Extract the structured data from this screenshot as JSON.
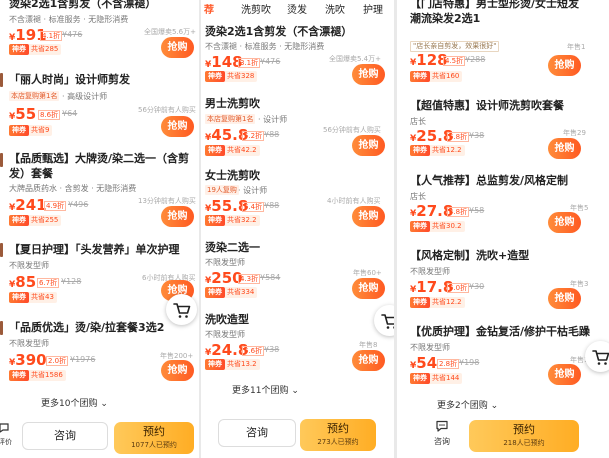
{
  "panels": {
    "left": {
      "top_partial": {
        "title": "烫染2选1含剪发（不含漂褪）",
        "subtitle": "不含漂褪 · 标准服务 · 无隐形消费",
        "price_symbol": "¥",
        "price": "191",
        "discount": "4.1折",
        "original": "¥476",
        "sales": "全国爆卖5.6万+",
        "cheap_label": "神券",
        "cheap_text": "共省285",
        "buy": "抢购"
      },
      "items": [
        {
          "title": "「丽人时尚」设计师剪发",
          "tag": "本店复购第1名",
          "subtitle": "· 高级设计师",
          "price_symbol": "¥",
          "price": "55",
          "discount": "8.6折",
          "original": "¥64",
          "recent": "56分钟前有人购买",
          "cheap_label": "神券",
          "cheap_text": "共省9",
          "buy": "抢购"
        },
        {
          "title_line1": "【品质甄选】大牌烫/染二选一（含剪",
          "title_line2": "发）套餐",
          "subtitle": "大牌品质药水 · 含剪发 · 无隐形消费",
          "price_symbol": "¥",
          "price": "241",
          "discount": "4.9折",
          "original": "¥496",
          "recent": "13分钟前有人购买",
          "cheap_label": "神券",
          "cheap_text": "共省255",
          "buy": "抢购"
        },
        {
          "title": "【夏日护理】「头发营养」单次护理",
          "subtitle": "不限发型师",
          "price_symbol": "¥",
          "price": "85",
          "discount": "6.7折",
          "original": "¥128",
          "recent": "6小时前有人购买",
          "cheap_label": "神券",
          "cheap_text": "共省43",
          "buy": "抢购"
        },
        {
          "title": "「品质优选」烫/染/拉套餐3选2",
          "subtitle": "不限发型师",
          "price_symbol": "¥",
          "price": "390",
          "discount": "2.0折",
          "original": "¥1976",
          "recent": "年售200+",
          "cheap_label": "神券",
          "cheap_text": "共省1586",
          "buy": "抢购"
        }
      ],
      "more": "更多10个团购",
      "consult": "咨询",
      "book": "预约",
      "book_count": "1077人已预约",
      "edge_label": "评价"
    },
    "middle": {
      "tabs": [
        "荐",
        "洗剪吹",
        "烫发",
        "洗吹",
        "护理"
      ],
      "items": [
        {
          "title": "烫染2选1含剪发（不含漂褪）",
          "subtitle": "不含漂褪 · 标准服务 · 无隐形消费",
          "price_symbol": "¥",
          "price": "148",
          "discount": "3.1折",
          "original": "¥476",
          "sales": "全国爆卖5.4万+",
          "cheap_label": "神券",
          "cheap_text": "共省328",
          "buy": "抢购"
        },
        {
          "title": "男士洗剪吹",
          "tag": "本店复购第1名",
          "subtitle": "· 设计师",
          "price_symbol": "¥",
          "price": "45.8",
          "discount": "5.2折",
          "original": "¥88",
          "recent": "56分钟前有人购买",
          "cheap_label": "神券",
          "cheap_text": "共省42.2",
          "buy": "抢购"
        },
        {
          "title": "女士洗剪吹",
          "tag": "19人复购",
          "subtitle": "· 设计师",
          "price_symbol": "¥",
          "price": "55.8",
          "discount": "6.4折",
          "original": "¥88",
          "recent": "4小时前有人购买",
          "cheap_label": "神券",
          "cheap_text": "共省32.2",
          "buy": "抢购"
        },
        {
          "title": "烫染二选一",
          "subtitle": "不限发型师",
          "price_symbol": "¥",
          "price": "250",
          "discount": "4.3折",
          "original": "¥584",
          "recent": "年售60+",
          "cheap_label": "神券",
          "cheap_text": "共省334",
          "buy": "抢购"
        },
        {
          "title": "洗吹造型",
          "subtitle": "不限发型师",
          "price_symbol": "¥",
          "price": "24.8",
          "discount": "6.6折",
          "original": "¥38",
          "recent": "年售8",
          "cheap_label": "神券",
          "cheap_text": "共省13.2",
          "buy": "抢购"
        }
      ],
      "more": "更多11个团购",
      "consult": "咨询",
      "book": "预约",
      "book_count": "273人已预约"
    },
    "right": {
      "items": [
        {
          "title_line1": "【门店特惠】男士型形烫/女士短发",
          "title_line2": "潮流染发2选1",
          "quote": "\"店长亲自剪发，效果很好\"",
          "price_symbol": "¥",
          "price": "128",
          "discount": "4.5折",
          "original": "¥288",
          "recent": "年售1",
          "cheap_label": "神券",
          "cheap_text": "共省160",
          "buy": "抢购"
        },
        {
          "title": "【超值特惠】设计师洗剪吹套餐",
          "subtitle": "店长",
          "price_symbol": "¥",
          "price": "25.8",
          "discount": "6.8折",
          "original": "¥38",
          "recent": "年售29",
          "cheap_label": "神券",
          "cheap_text": "共省12.2",
          "buy": "抢购"
        },
        {
          "title": "【人气推荐】总监剪发/风格定制",
          "subtitle": "店长",
          "price_symbol": "¥",
          "price": "27.8",
          "discount": "4.8折",
          "original": "¥58",
          "recent": "年售5",
          "cheap_label": "神券",
          "cheap_text": "共省30.2",
          "buy": "抢购"
        },
        {
          "title": "【风格定制】洗吹+造型",
          "subtitle": "不限发型师",
          "price_symbol": "¥",
          "price": "17.8",
          "discount": "6.0折",
          "original": "¥30",
          "recent": "年售3",
          "cheap_label": "神券",
          "cheap_text": "共省12.2",
          "buy": "抢购"
        },
        {
          "title": "【优质护理】金钻复活/修护干枯毛躁",
          "subtitle": "不限发型师",
          "price_symbol": "¥",
          "price": "54",
          "discount": "2.8折",
          "original": "¥198",
          "recent": "年售1",
          "cheap_label": "神券",
          "cheap_text": "共省144",
          "buy": "抢购"
        }
      ],
      "more": "更多2个团购",
      "consult": "咨询",
      "book": "预约",
      "book_count": "218人已预约"
    }
  },
  "colors": {
    "accent": "#ff5a22",
    "price": "#ff4a1c",
    "book": "#ffb62e"
  },
  "icons": [
    "cart-icon",
    "chevron-down-icon",
    "chat-icon",
    "star-icon"
  ]
}
